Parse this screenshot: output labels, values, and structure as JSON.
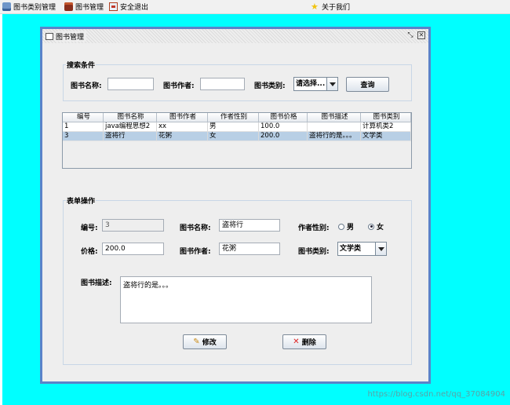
{
  "menu": {
    "items": [
      {
        "label": "图书类别管理",
        "icon": "book-stack-icon"
      },
      {
        "label": "图书管理",
        "icon": "briefcase-icon"
      },
      {
        "label": "安全退出",
        "icon": "exit-icon"
      }
    ],
    "about": {
      "label": "关于我们",
      "icon": "star-icon"
    }
  },
  "window": {
    "title": "图书管理"
  },
  "search": {
    "group_label": "搜索条件",
    "name_label": "图书名称:",
    "name_value": "",
    "author_label": "图书作者:",
    "author_value": "",
    "type_label": "图书类别:",
    "type_value": "请选择...",
    "query_button": "查询"
  },
  "table": {
    "columns": [
      "编号",
      "图书名称",
      "图书作者",
      "作者性别",
      "图书价格",
      "图书描述",
      "图书类别"
    ],
    "rows": [
      [
        "1",
        "java编程思想2",
        "xx",
        "男",
        "100.0",
        "",
        "计算机类2"
      ],
      [
        "3",
        "盗将行",
        "花粥",
        "女",
        "200.0",
        "盗将行的是。。。",
        "文学类"
      ]
    ],
    "selected_row": 1
  },
  "form": {
    "group_label": "表单操作",
    "id_label": "编号:",
    "id_value": "3",
    "name_label": "图书名称:",
    "name_value": "盗将行",
    "sex_label": "作者性别:",
    "sex_options": [
      "男",
      "女"
    ],
    "sex_selected": "女",
    "price_label": "价格:",
    "price_value": "200.0",
    "author_label": "图书作者:",
    "author_value": "花粥",
    "type_label": "图书类别:",
    "type_value": "文学类",
    "desc_label": "图书描述:",
    "desc_value": "盗将行的是。。。",
    "modify_button": "修改",
    "delete_button": "删除"
  },
  "watermark": "https://blog.csdn.net/qq_37084904"
}
